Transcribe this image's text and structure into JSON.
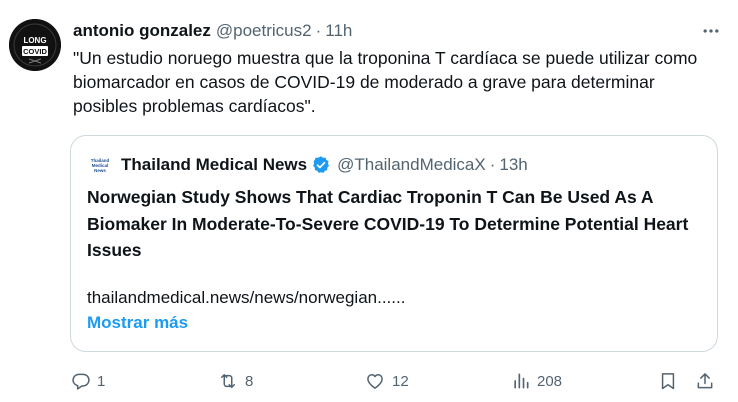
{
  "author": {
    "name": "antonio gonzalez",
    "handle": "@poetricus2",
    "separator": "·",
    "time": "11h",
    "avatar_text": [
      "LONG",
      "COVID"
    ]
  },
  "tweet": {
    "text": "\"Un estudio noruego muestra que la troponina T cardíaca se puede utilizar como biomarcador en casos de COVID-19 de moderado a grave para determinar posibles problemas cardíacos\"."
  },
  "quote": {
    "logo_text": [
      "Thailand",
      "Medical",
      "News"
    ],
    "name": "Thailand Medical News",
    "handle": "@ThailandMedicaX",
    "separator": "·",
    "time": "13h",
    "title": "Norwegian Study Shows That Cardiac Troponin T Can Be Used As A Biomaker In Moderate-To-Severe COVID-19 To Determine Potential Heart Issues",
    "link": "thailandmedical.news/news/norwegian......",
    "show_more": "Mostrar más"
  },
  "actions": {
    "replies": "1",
    "reposts": "8",
    "likes": "12",
    "views": "208"
  },
  "icons": {
    "more": "more-horizontal-icon",
    "reply": "reply-icon",
    "repost": "repost-icon",
    "like": "heart-icon",
    "views": "views-icon",
    "bookmark": "bookmark-icon",
    "share": "share-icon",
    "verified": "verified-badge-icon"
  },
  "colors": {
    "text": "#0f1419",
    "secondary": "#536471",
    "accent": "#1d9bf0",
    "border": "#cfd9de"
  }
}
